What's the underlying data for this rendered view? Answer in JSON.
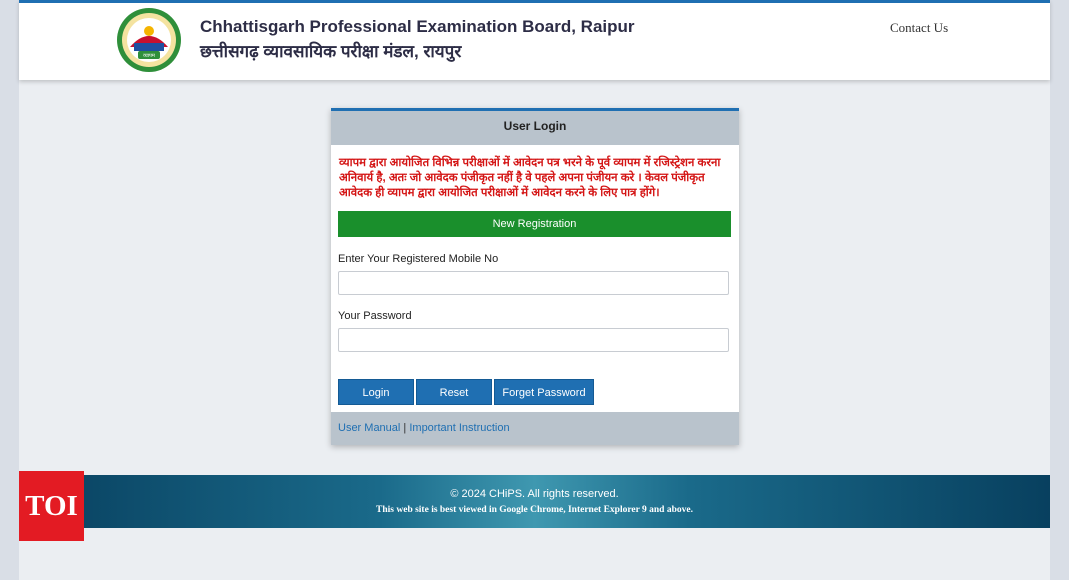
{
  "header": {
    "title_en": "Chhattisgarh Professional Examination Board, Raipur",
    "title_hi": "छत्तीसगढ़ व्यावसायिक परीक्षा मंडल, रायपुर",
    "logo_text": "व्यापम",
    "contact_label": "Contact Us"
  },
  "login": {
    "heading": "User Login",
    "notice": "व्यापम द्वारा आयोजित विभिन्न  परीक्षाओं में आवेदन पत्र भरने के पूर्व व्यापम में रजिस्ट्रेशन करना अनिवार्य है, अतः जो आवेदक पंजीकृत नहीं है वे पहले अपना  पंजीयन करे ।  केवल पंजीकृत आवेदक ही व्यापम द्वारा आयोजित परीक्षाओं में आवेदन करने के लिए पात्र होंगे।",
    "new_registration_label": "New Registration",
    "mobile_label": "Enter Your Registered Mobile No",
    "mobile_value": "",
    "password_label": "Your Password",
    "password_value": "",
    "login_button": "Login",
    "reset_button": "Reset",
    "forget_button": "Forget Password",
    "user_manual_link": "User Manual",
    "link_separator": "|",
    "instruction_link": "Important Instruction"
  },
  "footer": {
    "copyright": "© 2024 CHiPS. All rights reserved.",
    "browser_note": "This web site is best viewed in Google Chrome, Internet Explorer 9 and above."
  },
  "watermark": {
    "text": "TOI",
    "color": "#e31b23"
  },
  "colors": {
    "accent_blue": "#1f6fb2",
    "registration_green": "#1a8f2c",
    "notice_red": "#d41414"
  }
}
